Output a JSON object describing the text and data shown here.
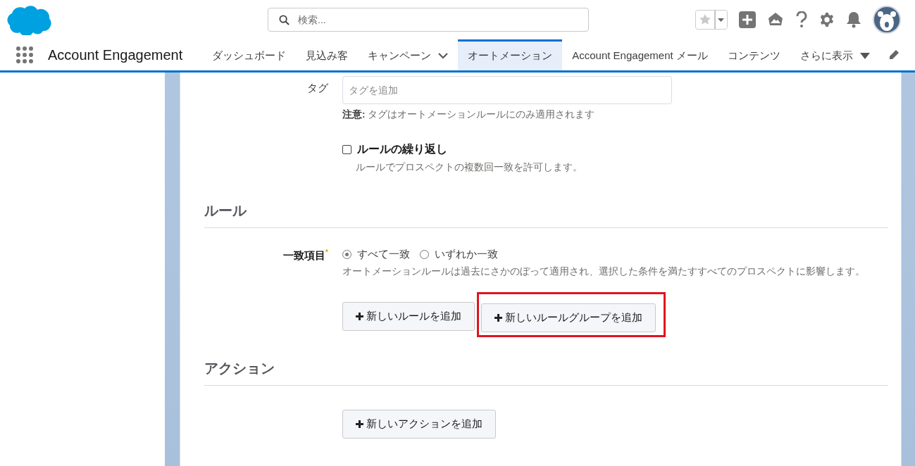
{
  "header": {
    "search": {
      "placeholder": "検索..."
    }
  },
  "nav": {
    "app_name": "Account Engagement",
    "tabs": [
      {
        "label": "ダッシュボード",
        "selected": false,
        "dropdown": false
      },
      {
        "label": "見込み客",
        "selected": false,
        "dropdown": false
      },
      {
        "label": "キャンペーン",
        "selected": false,
        "dropdown": true
      },
      {
        "label": "オートメーション",
        "selected": true,
        "dropdown": false
      },
      {
        "label": "Account Engagement メール",
        "selected": false,
        "dropdown": false
      },
      {
        "label": "コンテンツ",
        "selected": false,
        "dropdown": false
      }
    ],
    "more": "さらに表示"
  },
  "form": {
    "tag": {
      "label": "タグ",
      "placeholder": "タグを追加",
      "note": "**注意:** タグはオートメーションルールにのみ適用されます"
    },
    "repeat": {
      "label": "ルールの繰り返し",
      "checked": false,
      "help": "ルールでプロスペクトの複数回一致を許可します。"
    },
    "rules": {
      "heading": "ルール",
      "match_label": "一致項目",
      "required_mark": "*",
      "options": [
        {
          "label": "すべて一致",
          "selected": true
        },
        {
          "label": "いずれか一致",
          "selected": false
        }
      ],
      "help": "オートメーションルールは過去にさかのぼって適用され、選択した条件を満たすすべてのプロスペクトに影響します。",
      "buttons": [
        {
          "label": "新しいルールを追加",
          "highlighted": false
        },
        {
          "label": "新しいルールグループを追加",
          "highlighted": true
        }
      ]
    },
    "actions": {
      "heading": "アクション",
      "button": "新しいアクションを追加"
    }
  }
}
